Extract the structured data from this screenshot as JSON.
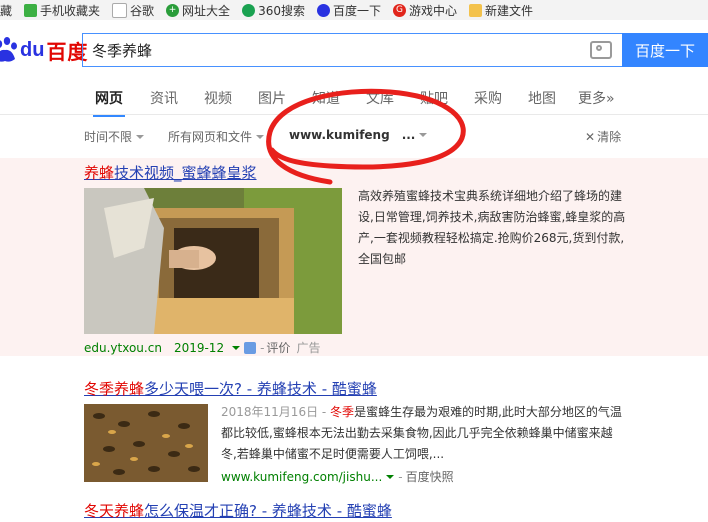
{
  "bookmarks": [
    {
      "label": "藏",
      "icon": "none"
    },
    {
      "label": "手机收藏夹",
      "icon": "phone-icon"
    },
    {
      "label": "谷歌",
      "icon": "page-icon"
    },
    {
      "label": "网址大全",
      "icon": "plus-icon"
    },
    {
      "label": "360搜索",
      "icon": "360-icon"
    },
    {
      "label": "百度一下",
      "icon": "baidu-paw-icon"
    },
    {
      "label": "游戏中心",
      "icon": "game-icon"
    },
    {
      "label": "新建文件",
      "icon": "folder-icon"
    }
  ],
  "logo": {
    "du": "du",
    "name": "百度"
  },
  "search": {
    "query": "冬季养蜂",
    "button": "百度一下"
  },
  "tabs": [
    "网页",
    "资讯",
    "视频",
    "图片",
    "知道",
    "文库",
    "贴吧",
    "采购",
    "地图",
    "更多»"
  ],
  "filters": {
    "time": "时间不限",
    "type": "所有网页和文件",
    "site": "www.kumifeng",
    "site_more": "...",
    "clear": "清除"
  },
  "results": [
    {
      "title_em": "养蜂",
      "title_rest": "技术视频_蜜蜂蜂皇浆",
      "text": "高效养殖蜜蜂技术宝典系统详细地介绍了蜂场的建设,日常管理,饲养技术,病敌害防治蜂蜜,蜂皇浆的高产,一套视频教程轻松搞定.抢购价268元,货到付款,全国包邮",
      "url": "edu.ytxou.cn",
      "date": "2019-12",
      "review": "评价",
      "ad": "广告"
    },
    {
      "title_em": "冬季养蜂",
      "title_rest": "多少天喂一次? - 养蜂技术 - 酷蜜蜂",
      "date": "2018年11月16日 - ",
      "text_em": "冬季",
      "text": "是蜜蜂生存最为艰难的时期,此时大部分地区的气温都比较低,蜜蜂根本无法出勤去采集食物,因此几乎完全依赖蜂巢中储蜜来越冬,若蜂巢中储蜜不足时便需要人工饲喂,...",
      "url": "www.kumifeng.com/jishu...",
      "snapshot": "百度快照"
    },
    {
      "title_em": "冬天养蜂",
      "title_rest": "怎么保温才正确? - 养蜂技术 - 酷蜜蜂"
    }
  ],
  "colors": {
    "accent": "#3385ff",
    "title": "#2440b3",
    "highlight": "#e10602",
    "url": "#008000",
    "annotation": "#e8201c"
  }
}
